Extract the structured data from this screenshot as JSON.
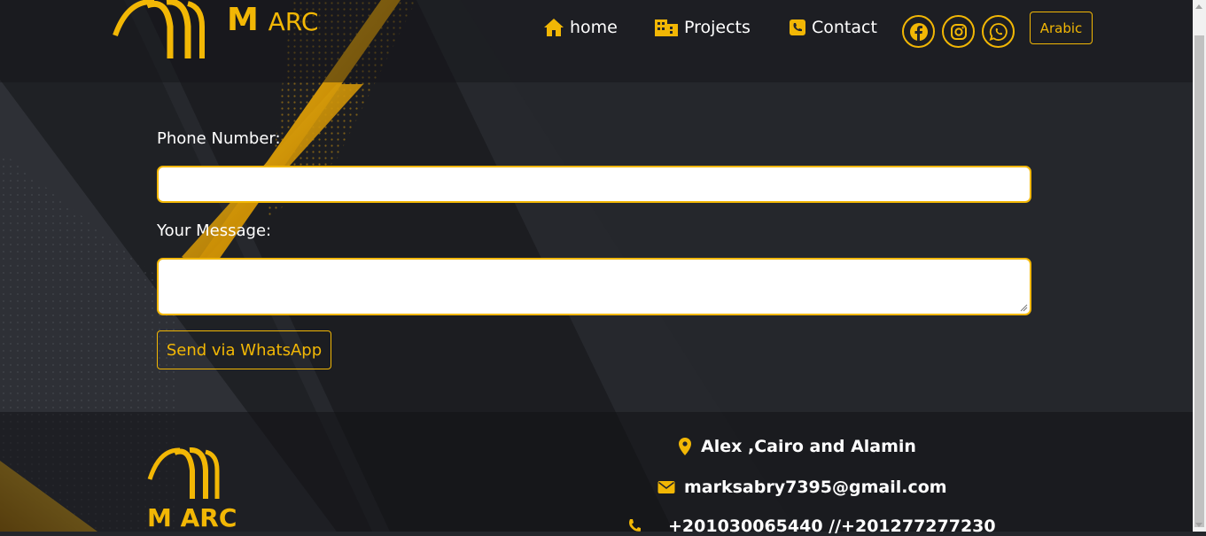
{
  "colors": {
    "accent": "#f2b705",
    "background": "#24262b",
    "text": "#ffffff"
  },
  "header": {
    "brand_m": "M",
    "brand_arc": "ARC",
    "nav": [
      {
        "label": "home",
        "icon": "house-icon"
      },
      {
        "label": "Projects",
        "icon": "building-icon"
      },
      {
        "label": "Contact",
        "icon": "phone-square-icon"
      }
    ],
    "social": [
      {
        "name": "facebook-icon"
      },
      {
        "name": "instagram-icon"
      },
      {
        "name": "whatsapp-icon"
      }
    ],
    "language_button": "Arabic"
  },
  "form": {
    "phone_label": "Phone Number:",
    "phone_value": "",
    "message_label": "Your Message:",
    "message_value": "",
    "send_button": "Send via WhatsApp"
  },
  "footer": {
    "brand": "M ARC",
    "location": "Alex ,Cairo and Alamin",
    "email": "marksabry7395@gmail.com",
    "phones": "+201030065440 //+201277277230"
  }
}
